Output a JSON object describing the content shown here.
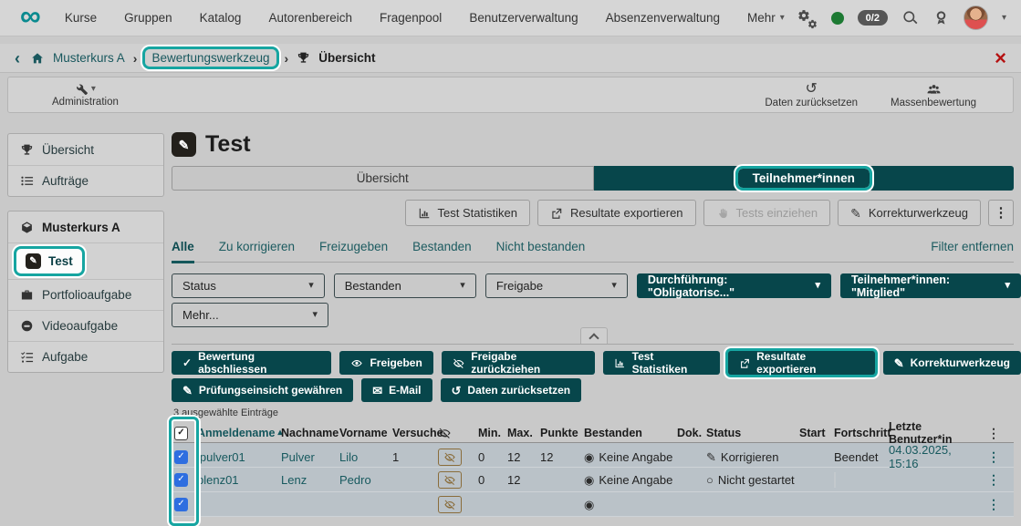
{
  "colors": {
    "brand_teal": "#0a8a8f",
    "dark_teal": "#07464b",
    "highlight_ring": "#16a5a1",
    "link_teal": "#17595e",
    "checkbox_blue": "#2e6ee0",
    "badge_brown": "#8a6d3b",
    "close_red": "#b51212",
    "presence_green": "#1d7a33",
    "row_bg": "#bac2c8"
  },
  "icons": {
    "infinity": "∞",
    "caret_down": "▾",
    "chevron_left": "‹",
    "separator": "›",
    "close": "×",
    "check": "✓",
    "pen": "✎",
    "mail": "✉",
    "undo": "↺",
    "dots": "⋮",
    "sort_asc": "▴",
    "radio_selected": "◉",
    "circle_empty": "○"
  },
  "navbar": {
    "items": [
      "Kurse",
      "Gruppen",
      "Katalog",
      "Autorenbereich",
      "Fragenpool",
      "Benutzerverwaltung",
      "Absenzenverwaltung"
    ],
    "more_label": "Mehr",
    "badge": "0/2"
  },
  "breadcrumb": {
    "course": "Musterkurs A",
    "tool": "Bewertungswerkzeug",
    "page": "Übersicht"
  },
  "admin_toolbar": {
    "administration": "Administration",
    "reset_data": "Daten zurücksetzen",
    "bulk_assessment": "Massenbewertung"
  },
  "sidebar": {
    "group1": {
      "overview": "Übersicht",
      "orders": "Aufträge"
    },
    "group2": {
      "course": "Musterkurs A",
      "test": "Test",
      "portfolio": "Portfolioaufgabe",
      "video": "Videoaufgabe",
      "task": "Aufgabe"
    }
  },
  "main": {
    "title": "Test",
    "tabs": {
      "overview": "Übersicht",
      "participants": "Teilnehmer*innen"
    },
    "toolbar": {
      "statistics": "Test Statistiken",
      "export": "Resultate exportieren",
      "pullin": "Tests einziehen",
      "correction": "Korrekturwerkzeug"
    },
    "filter_tabs": {
      "all": "Alle",
      "to_correct": "Zu korrigieren",
      "to_release": "Freizugeben",
      "passed": "Bestanden",
      "failed": "Nicht bestanden",
      "remove_filter": "Filter entfernen"
    },
    "filters": {
      "status": "Status",
      "passed": "Bestanden",
      "release": "Freigabe",
      "execution": "Durchführung: \"Obligatorisc...\"",
      "participants": "Teilnehmer*innen: \"Mitglied\"",
      "more": "Mehr..."
    },
    "batch_row1": {
      "finish": "Bewertung abschliessen",
      "release": "Freigeben",
      "withdraw": "Freigabe zurückziehen",
      "statistics": "Test Statistiken",
      "export": "Resultate exportieren",
      "correction": "Korrekturwerkzeug"
    },
    "batch_row2": {
      "inspection": "Prüfungseinsicht gewähren",
      "email": "E-Mail",
      "reset": "Daten zurücksetzen"
    },
    "selected_info": "3 ausgewählte Einträge",
    "table": {
      "headers": {
        "login": "Anmeldename",
        "lastname": "Nachname",
        "firstname": "Vorname",
        "attempts": "Versuche",
        "min": "Min.",
        "max": "Max.",
        "points": "Punkte",
        "passed": "Bestanden",
        "doc": "Dok.",
        "status": "Status",
        "start": "Start",
        "progress": "Fortschritt",
        "lastuser": "Letzte Benutzer*in"
      },
      "rows": [
        {
          "anmeldename": "lpulver01",
          "nachname": "Pulver",
          "vorname": "Lilo",
          "versuche": "1",
          "min": "0",
          "max": "12",
          "punkte": "12",
          "bestanden": "Keine Angabe",
          "dok": "",
          "status": "Korrigieren",
          "start": "",
          "fortschritt": "Beendet",
          "letzte": "04.03.2025, 15:16"
        },
        {
          "anmeldename": "plenz01",
          "nachname": "Lenz",
          "vorname": "Pedro",
          "versuche": "",
          "min": "0",
          "max": "12",
          "punkte": "",
          "bestanden": "Keine Angabe",
          "dok": "",
          "status": "Nicht gestartet",
          "start": "",
          "fortschritt": "",
          "letzte": ""
        },
        {
          "anmeldename": "",
          "nachname": "",
          "vorname": "",
          "versuche": "",
          "min": "",
          "max": "",
          "punkte": "",
          "bestanden": "",
          "dok": "",
          "status": "",
          "start": "",
          "fortschritt": "",
          "letzte": ""
        }
      ]
    }
  }
}
